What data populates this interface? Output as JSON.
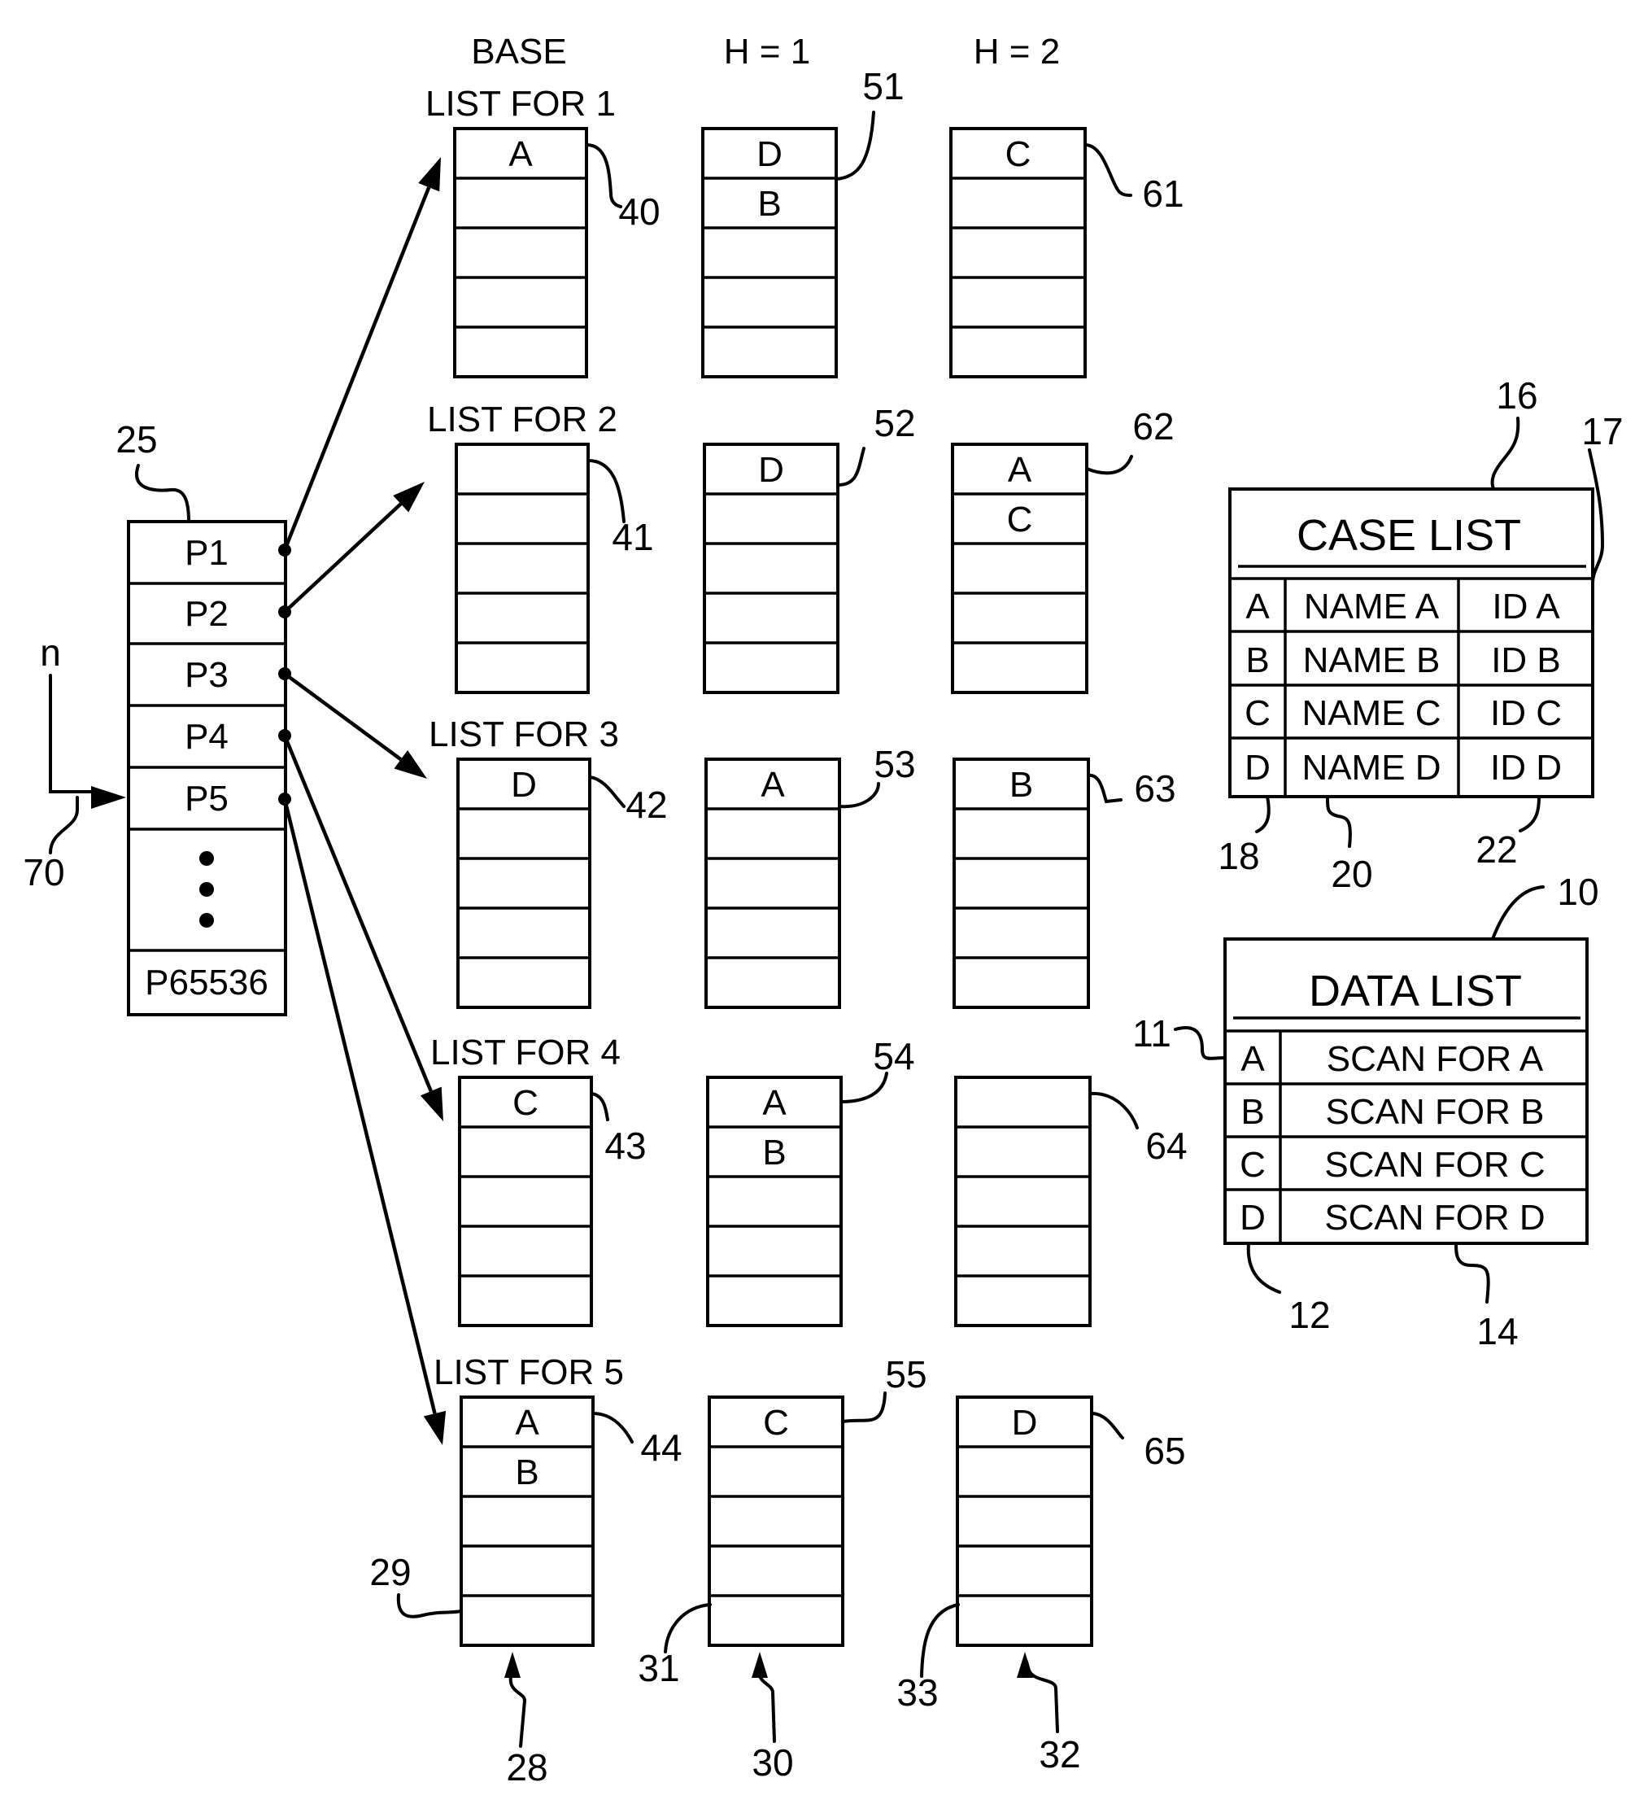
{
  "column_headers": [
    "BASE",
    "H = 1",
    "H = 2"
  ],
  "pointer_table": {
    "ref": "25",
    "entries": [
      "P1",
      "P2",
      "P3",
      "P4",
      "P5"
    ],
    "ellipsis": "•",
    "last_entry": "P65536",
    "index_label": "n",
    "index_ref": "70"
  },
  "list_groups": [
    {
      "title": "LIST FOR 1",
      "columns": [
        {
          "ref": "40",
          "cells": [
            "A",
            "",
            "",
            "",
            ""
          ]
        },
        {
          "ref": "51",
          "cells": [
            "D",
            "B",
            "",
            "",
            ""
          ]
        },
        {
          "ref": "61",
          "cells": [
            "C",
            "",
            "",
            "",
            ""
          ]
        }
      ]
    },
    {
      "title": "LIST FOR 2",
      "columns": [
        {
          "ref": "41",
          "cells": [
            "",
            "",
            "",
            "",
            ""
          ]
        },
        {
          "ref": "52",
          "cells": [
            "D",
            "",
            "",
            "",
            ""
          ]
        },
        {
          "ref": "62",
          "cells": [
            "A",
            "C",
            "",
            "",
            ""
          ]
        }
      ]
    },
    {
      "title": "LIST FOR 3",
      "columns": [
        {
          "ref": "42",
          "cells": [
            "D",
            "",
            "",
            "",
            ""
          ]
        },
        {
          "ref": "53",
          "cells": [
            "A",
            "",
            "",
            "",
            ""
          ]
        },
        {
          "ref": "63",
          "cells": [
            "B",
            "",
            "",
            "",
            ""
          ]
        }
      ]
    },
    {
      "title": "LIST FOR 4",
      "columns": [
        {
          "ref": "43",
          "cells": [
            "C",
            "",
            "",
            "",
            ""
          ]
        },
        {
          "ref": "54",
          "cells": [
            "A",
            "B",
            "",
            "",
            ""
          ]
        },
        {
          "ref": "64",
          "cells": [
            "",
            "",
            "",
            "",
            ""
          ]
        }
      ]
    },
    {
      "title": "LIST FOR 5",
      "columns": [
        {
          "ref": "44",
          "cells": [
            "A",
            "B",
            "",
            "",
            ""
          ]
        },
        {
          "ref": "55",
          "cells": [
            "C",
            "",
            "",
            "",
            ""
          ]
        },
        {
          "ref": "65",
          "cells": [
            "D",
            "",
            "",
            "",
            ""
          ]
        }
      ]
    }
  ],
  "bottom_refs": {
    "cell_refs": [
      "29",
      "31",
      "33"
    ],
    "column_refs": [
      "28",
      "30",
      "32"
    ]
  },
  "case_list": {
    "title": "CASE LIST",
    "ref": "16",
    "row_ref": "17",
    "column_refs": [
      "18",
      "20",
      "22"
    ],
    "rows": [
      [
        "A",
        "NAME A",
        "ID A"
      ],
      [
        "B",
        "NAME B",
        "ID B"
      ],
      [
        "C",
        "NAME C",
        "ID C"
      ],
      [
        "D",
        "NAME D",
        "ID D"
      ]
    ]
  },
  "data_list": {
    "title": "DATA LIST",
    "ref": "10",
    "row_ref": "11",
    "column_refs": [
      "12",
      "14"
    ],
    "rows": [
      [
        "A",
        "SCAN FOR A"
      ],
      [
        "B",
        "SCAN FOR B"
      ],
      [
        "C",
        "SCAN FOR C"
      ],
      [
        "D",
        "SCAN FOR D"
      ]
    ]
  }
}
